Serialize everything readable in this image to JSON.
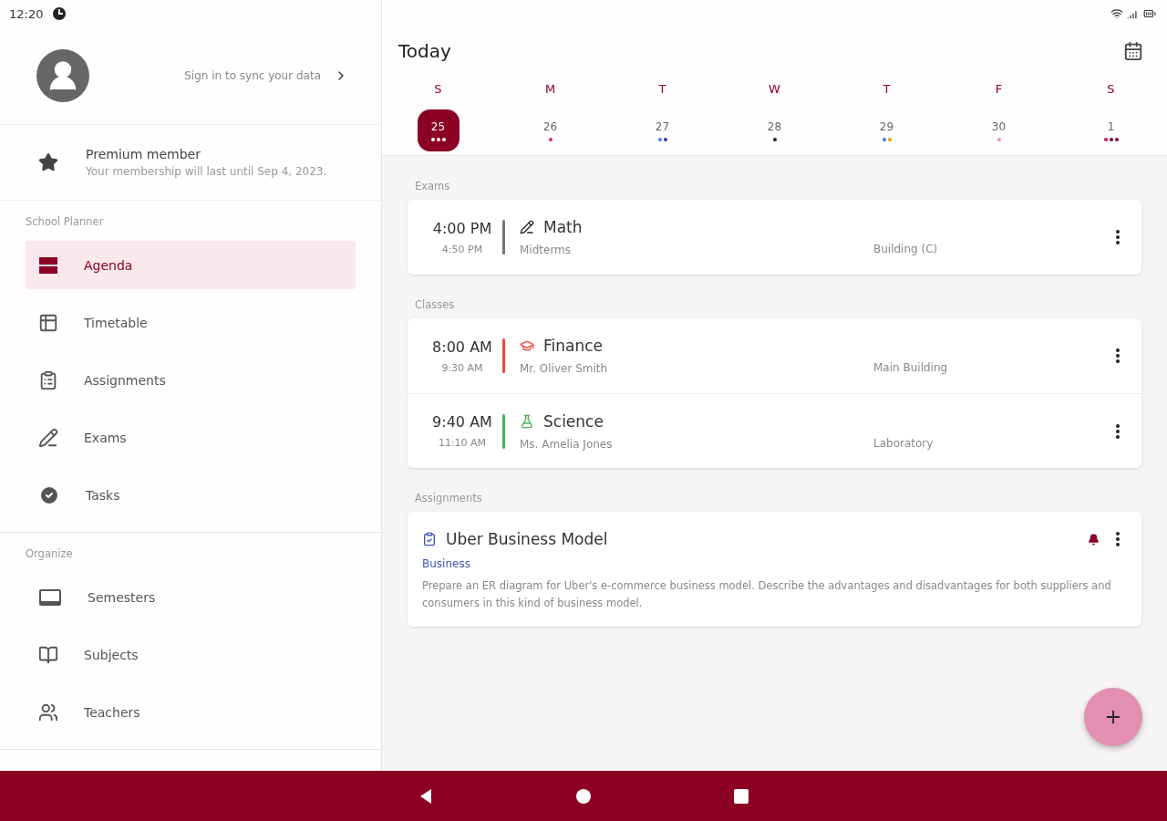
{
  "status_bar": {
    "time": "12:20"
  },
  "drawer": {
    "account": {
      "prompt": "Sign in to sync your data"
    },
    "premium": {
      "title": "Premium member",
      "subtitle": "Your membership will last until Sep 4, 2023."
    },
    "sections": [
      {
        "title": "School Planner",
        "items": [
          {
            "label": "Agenda",
            "selected": true
          },
          {
            "label": "Timetable",
            "selected": false
          },
          {
            "label": "Assignments",
            "selected": false
          },
          {
            "label": "Exams",
            "selected": false
          },
          {
            "label": "Tasks",
            "selected": false
          }
        ]
      },
      {
        "title": "Organize",
        "items": [
          {
            "label": "Semesters",
            "selected": false
          },
          {
            "label": "Subjects",
            "selected": false
          },
          {
            "label": "Teachers",
            "selected": false
          }
        ]
      }
    ]
  },
  "agenda": {
    "title": "Today",
    "week": [
      {
        "weekday": "S",
        "date": "25",
        "selected": true,
        "dots": [
          {
            "color": "#ffffff"
          },
          {
            "color": "#ffffff"
          },
          {
            "color": "#ffffff"
          }
        ]
      },
      {
        "weekday": "M",
        "date": "26",
        "selected": false,
        "dots": [
          {
            "color": "#e0245e"
          }
        ]
      },
      {
        "weekday": "T",
        "date": "27",
        "selected": false,
        "dots": [
          {
            "color": "#4a7bff"
          },
          {
            "color": "#2a3aa8"
          }
        ]
      },
      {
        "weekday": "W",
        "date": "28",
        "selected": false,
        "dots": [
          {
            "color": "#222222"
          }
        ]
      },
      {
        "weekday": "T",
        "date": "29",
        "selected": false,
        "dots": [
          {
            "color": "#3a7bff"
          },
          {
            "color": "#ff9800"
          }
        ]
      },
      {
        "weekday": "F",
        "date": "30",
        "selected": false,
        "dots": [
          {
            "color": "#f48fb1"
          }
        ]
      },
      {
        "weekday": "S",
        "date": "1",
        "selected": false,
        "dots": [
          {
            "color": "#c2185b"
          },
          {
            "color": "#8b0024"
          },
          {
            "color": "#8b0024"
          }
        ]
      }
    ],
    "sections": [
      {
        "title": "Exams",
        "entries": [
          {
            "kind": "event",
            "start": "4:00 PM",
            "end": "4:50 PM",
            "title": "Math",
            "subtitle": "Midterms",
            "location": "Building (C)",
            "color": "#757575"
          }
        ]
      },
      {
        "title": "Classes",
        "entries": [
          {
            "kind": "event",
            "start": "8:00 AM",
            "end": "9:30 AM",
            "title": "Finance",
            "subtitle": "Mr. Oliver Smith",
            "location": "Main Building",
            "color": "#f44336"
          },
          {
            "kind": "event",
            "start": "9:40 AM",
            "end": "11:10 AM",
            "title": "Science",
            "subtitle": "Ms. Amelia Jones",
            "location": "Laboratory",
            "color": "#4caf50"
          }
        ]
      },
      {
        "title": "Assignments",
        "entries": [
          {
            "kind": "assignment",
            "title": "Uber Business Model",
            "subject": "Business",
            "description": "Prepare an ER diagram for Uber's e-commerce business model. Describe the advantages and disadvantages for both suppliers and consumers in this kind of business model.",
            "color": "#3f51b5",
            "reminder": true
          }
        ]
      }
    ]
  }
}
